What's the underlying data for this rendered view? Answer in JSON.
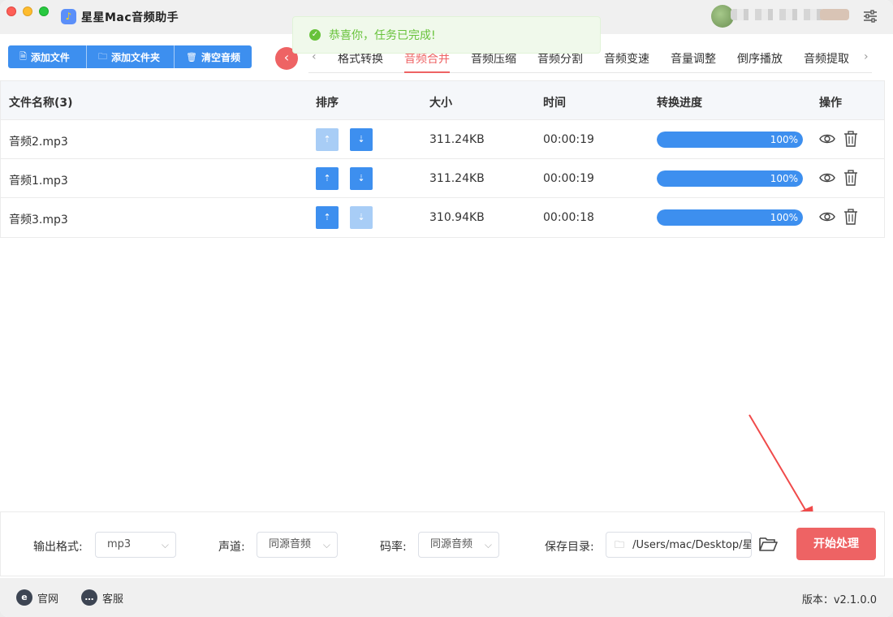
{
  "app": {
    "title": "星星Mac音频助手",
    "user": ""
  },
  "toast": {
    "message": "恭喜你，任务已完成!"
  },
  "toolbar": {
    "add_file": "添加文件",
    "add_folder": "添加文件夹",
    "clear": "清空音频"
  },
  "tabs": [
    {
      "label": "格式转换",
      "active": false
    },
    {
      "label": "音频合并",
      "active": true
    },
    {
      "label": "音频压缩",
      "active": false
    },
    {
      "label": "音频分割",
      "active": false
    },
    {
      "label": "音频变速",
      "active": false
    },
    {
      "label": "音量调整",
      "active": false
    },
    {
      "label": "倒序播放",
      "active": false
    },
    {
      "label": "音频提取",
      "active": false
    }
  ],
  "table": {
    "headers": {
      "name": "文件名称(3)",
      "sort": "排序",
      "size": "大小",
      "time": "时间",
      "progress": "转换进度",
      "actions": "操作"
    },
    "rows": [
      {
        "name": "音频2.mp3",
        "size": "311.24KB",
        "time": "00:00:19",
        "progress": "100%",
        "up_enabled": false,
        "down_enabled": true
      },
      {
        "name": "音频1.mp3",
        "size": "311.24KB",
        "time": "00:00:19",
        "progress": "100%",
        "up_enabled": true,
        "down_enabled": true
      },
      {
        "name": "音频3.mp3",
        "size": "310.94KB",
        "time": "00:00:18",
        "progress": "100%",
        "up_enabled": true,
        "down_enabled": false
      }
    ]
  },
  "settings": {
    "format_label": "输出格式:",
    "format_value": "mp3",
    "channel_label": "声道:",
    "channel_value": "同源音频",
    "bitrate_label": "码率:",
    "bitrate_value": "同源音频",
    "save_label": "保存目录:",
    "save_path": "/Users/mac/Desktop/星",
    "start_button": "开始处理"
  },
  "footer": {
    "website": "官网",
    "service": "客服",
    "version": "版本：v2.1.0.0"
  },
  "colors": {
    "accent_blue": "#3d8fef",
    "accent_red": "#ee6364",
    "success_green": "#67c23a"
  }
}
